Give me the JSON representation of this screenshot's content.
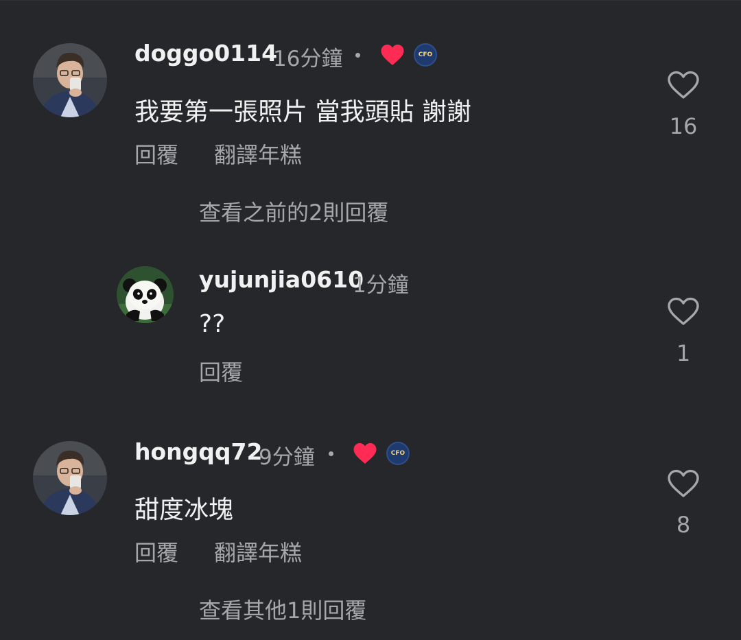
{
  "colors": {
    "background": "#26272b",
    "primary_text": "#f1f1f1",
    "secondary_text": "#a6a7ab",
    "like_red": "#fe2c55"
  },
  "comments": [
    {
      "username": "doggo0114",
      "time": "16分鐘",
      "creator_liked": true,
      "badge_text": "CFO",
      "text": "我要第一張照片 當我頭貼 謝謝",
      "reply_label": "回覆",
      "translate_label": "翻譯年糕",
      "like_count": "16",
      "view_replies": "查看之前的2則回覆"
    },
    {
      "username": "yujunjia0610",
      "time": "1分鐘",
      "text": "??",
      "reply_label": "回覆",
      "like_count": "1"
    },
    {
      "username": "hongqq72",
      "time": "9分鐘",
      "creator_liked": true,
      "badge_text": "CFO",
      "text": "甜度冰塊",
      "reply_label": "回覆",
      "translate_label": "翻譯年糕",
      "like_count": "8",
      "view_replies": "查看其他1則回覆"
    }
  ]
}
